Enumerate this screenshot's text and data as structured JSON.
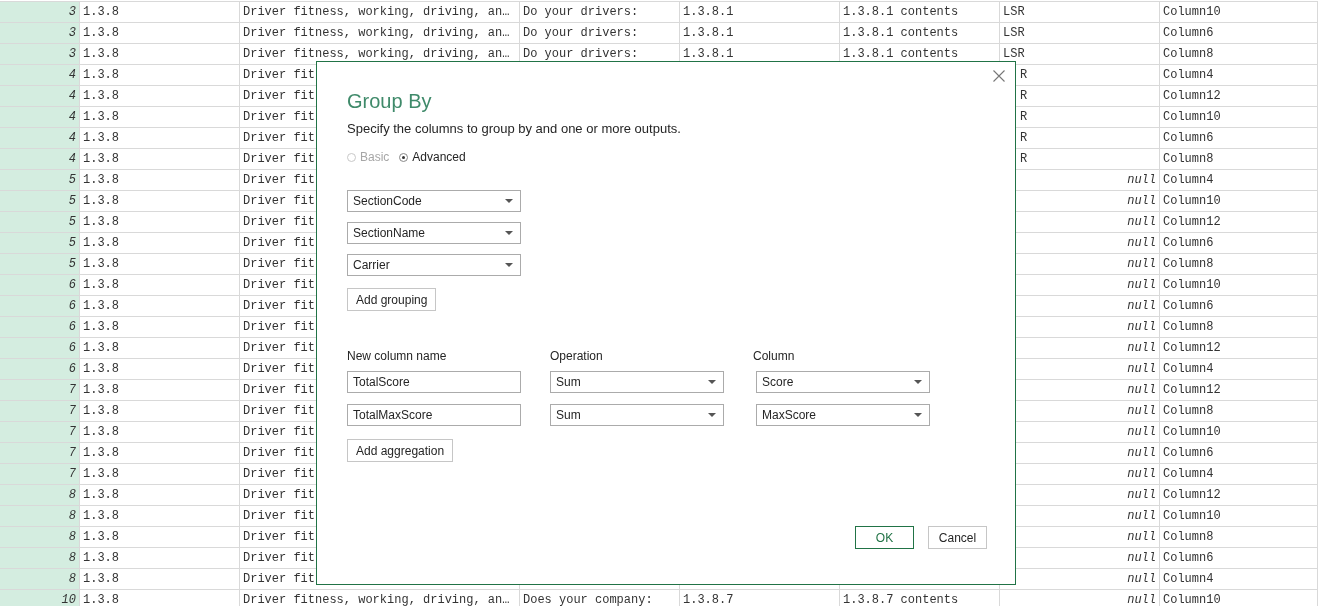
{
  "table": {
    "rows": [
      {
        "index": "3",
        "cells": [
          "1.3.8",
          "Driver fitness, working, driving, an…",
          "Do your drivers:",
          "1.3.8.1",
          "1.3.8.1 contents",
          "LSR",
          "Column10"
        ]
      },
      {
        "index": "3",
        "cells": [
          "1.3.8",
          "Driver fitness, working, driving, an…",
          "Do your drivers:",
          "1.3.8.1",
          "1.3.8.1 contents",
          "LSR",
          "Column6"
        ]
      },
      {
        "index": "3",
        "cells": [
          "1.3.8",
          "Driver fitness, working, driving, an…",
          "Do your drivers:",
          "1.3.8.1",
          "1.3.8.1 contents",
          "LSR",
          "Column8"
        ]
      },
      {
        "index": "4",
        "cells": [
          "1.3.8",
          "Driver fit",
          "",
          "",
          "",
          {
            "text": "R",
            "kind": "clipped"
          },
          "Column4"
        ]
      },
      {
        "index": "4",
        "cells": [
          "1.3.8",
          "Driver fit",
          "",
          "",
          "",
          {
            "text": "R",
            "kind": "clipped"
          },
          "Column12"
        ]
      },
      {
        "index": "4",
        "cells": [
          "1.3.8",
          "Driver fit",
          "",
          "",
          "",
          {
            "text": "R",
            "kind": "clipped"
          },
          "Column10"
        ]
      },
      {
        "index": "4",
        "cells": [
          "1.3.8",
          "Driver fit",
          "",
          "",
          "",
          {
            "text": "R",
            "kind": "clipped"
          },
          "Column6"
        ]
      },
      {
        "index": "4",
        "cells": [
          "1.3.8",
          "Driver fit",
          "",
          "",
          "",
          {
            "text": "R",
            "kind": "clipped"
          },
          "Column8"
        ]
      },
      {
        "index": "5",
        "cells": [
          "1.3.8",
          "Driver fit",
          "",
          "",
          "",
          {
            "text": "null",
            "kind": "null"
          },
          "Column4"
        ]
      },
      {
        "index": "5",
        "cells": [
          "1.3.8",
          "Driver fit",
          "",
          "",
          "",
          {
            "text": "null",
            "kind": "null"
          },
          "Column10"
        ]
      },
      {
        "index": "5",
        "cells": [
          "1.3.8",
          "Driver fit",
          "",
          "",
          "",
          {
            "text": "null",
            "kind": "null"
          },
          "Column12"
        ]
      },
      {
        "index": "5",
        "cells": [
          "1.3.8",
          "Driver fit",
          "",
          "",
          "",
          {
            "text": "null",
            "kind": "null"
          },
          "Column6"
        ]
      },
      {
        "index": "5",
        "cells": [
          "1.3.8",
          "Driver fit",
          "",
          "",
          "",
          {
            "text": "null",
            "kind": "null"
          },
          "Column8"
        ]
      },
      {
        "index": "6",
        "cells": [
          "1.3.8",
          "Driver fit",
          "",
          "",
          "",
          {
            "text": "null",
            "kind": "null"
          },
          "Column10"
        ]
      },
      {
        "index": "6",
        "cells": [
          "1.3.8",
          "Driver fit",
          "",
          "",
          "",
          {
            "text": "null",
            "kind": "null"
          },
          "Column6"
        ]
      },
      {
        "index": "6",
        "cells": [
          "1.3.8",
          "Driver fit",
          "",
          "",
          "",
          {
            "text": "null",
            "kind": "null"
          },
          "Column8"
        ]
      },
      {
        "index": "6",
        "cells": [
          "1.3.8",
          "Driver fit",
          "",
          "",
          "",
          {
            "text": "null",
            "kind": "null"
          },
          "Column12"
        ]
      },
      {
        "index": "6",
        "cells": [
          "1.3.8",
          "Driver fit",
          "",
          "",
          "",
          {
            "text": "null",
            "kind": "null"
          },
          "Column4"
        ]
      },
      {
        "index": "7",
        "cells": [
          "1.3.8",
          "Driver fit",
          "",
          "",
          "",
          {
            "text": "null",
            "kind": "null"
          },
          "Column12"
        ]
      },
      {
        "index": "7",
        "cells": [
          "1.3.8",
          "Driver fit",
          "",
          "",
          "",
          {
            "text": "null",
            "kind": "null"
          },
          "Column8"
        ]
      },
      {
        "index": "7",
        "cells": [
          "1.3.8",
          "Driver fit",
          "",
          "",
          "",
          {
            "text": "null",
            "kind": "null"
          },
          "Column10"
        ]
      },
      {
        "index": "7",
        "cells": [
          "1.3.8",
          "Driver fit",
          "",
          "",
          "",
          {
            "text": "null",
            "kind": "null"
          },
          "Column6"
        ]
      },
      {
        "index": "7",
        "cells": [
          "1.3.8",
          "Driver fit",
          "",
          "",
          "",
          {
            "text": "null",
            "kind": "null"
          },
          "Column4"
        ]
      },
      {
        "index": "8",
        "cells": [
          "1.3.8",
          "Driver fit",
          "",
          "",
          "",
          {
            "text": "null",
            "kind": "null"
          },
          "Column12"
        ]
      },
      {
        "index": "8",
        "cells": [
          "1.3.8",
          "Driver fit",
          "",
          "",
          "",
          {
            "text": "null",
            "kind": "null"
          },
          "Column10"
        ]
      },
      {
        "index": "8",
        "cells": [
          "1.3.8",
          "Driver fit",
          "",
          "",
          "",
          {
            "text": "null",
            "kind": "null"
          },
          "Column8"
        ]
      },
      {
        "index": "8",
        "cells": [
          "1.3.8",
          "Driver fit",
          "",
          "",
          "",
          {
            "text": "null",
            "kind": "null"
          },
          "Column6"
        ]
      },
      {
        "index": "8",
        "cells": [
          "1.3.8",
          "Driver fit",
          "",
          "",
          "",
          {
            "text": "null",
            "kind": "null"
          },
          "Column4"
        ]
      },
      {
        "index": "10",
        "cells": [
          "1.3.8",
          "Driver fitness, working, driving, an…",
          "Does your company:",
          "1.3.8.7",
          "1.3.8.7 contents",
          {
            "text": "null",
            "kind": "null"
          },
          "Column10"
        ]
      }
    ]
  },
  "dialog": {
    "title": "Group By",
    "description": "Specify the columns to group by and one or more outputs.",
    "modes": [
      {
        "label": "Basic",
        "selected": false,
        "disabled": true
      },
      {
        "label": "Advanced",
        "selected": true,
        "disabled": false
      }
    ],
    "grouping": [
      "SectionCode",
      "SectionName",
      "Carrier"
    ],
    "add_grouping": "Add grouping",
    "aggregation_headers": [
      "New column name",
      "Operation",
      "Column"
    ],
    "aggregations": [
      {
        "name": "TotalScore",
        "operation": "Sum",
        "column": "Score"
      },
      {
        "name": "TotalMaxScore",
        "operation": "Sum",
        "column": "MaxScore"
      }
    ],
    "add_aggregation": "Add aggregation",
    "buttons": [
      {
        "label": "OK",
        "primary": true
      },
      {
        "label": "Cancel",
        "primary": false
      }
    ]
  }
}
